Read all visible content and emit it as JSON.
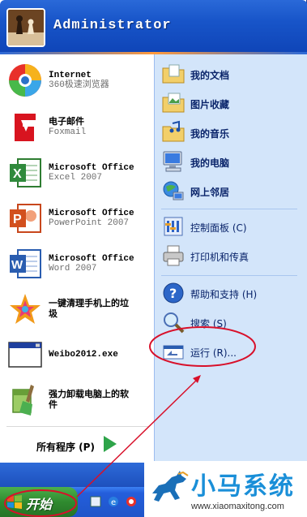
{
  "header": {
    "user_name": "Administrator"
  },
  "programs": [
    {
      "title": "Internet",
      "subtitle": "360极速浏览器"
    },
    {
      "title": "电子邮件",
      "subtitle": "Foxmail"
    },
    {
      "title": "Microsoft Office",
      "subtitle": "Excel 2007"
    },
    {
      "title": "Microsoft Office",
      "subtitle": "PowerPoint 2007"
    },
    {
      "title": "Microsoft Office",
      "subtitle": "Word 2007"
    },
    {
      "title": "一键清理手机上的垃",
      "subtitle": "圾"
    },
    {
      "title": "Weibo2012.exe",
      "subtitle": ""
    },
    {
      "title": "强力卸载电脑上的软",
      "subtitle": "件"
    }
  ],
  "all_programs": {
    "label": "所有程序 (P)"
  },
  "places": [
    {
      "label": "我的文档"
    },
    {
      "label": "图片收藏"
    },
    {
      "label": "我的音乐"
    },
    {
      "label": "我的电脑"
    },
    {
      "label": "网上邻居"
    },
    {
      "label": "控制面板 (C)"
    },
    {
      "label": "打印机和传真"
    },
    {
      "label": "帮助和支持 (H)"
    },
    {
      "label": "搜索 (S)"
    },
    {
      "label": "运行 (R)..."
    }
  ],
  "taskbar": {
    "start_label": "开始"
  },
  "watermark": {
    "brand": "小马系统",
    "url": "www.xiaomaxitong.com"
  },
  "colors": {
    "header_blue": "#1855c9",
    "right_panel": "#d3e5fa",
    "start_green": "#2f8a2f",
    "annotation_red": "#d8102a"
  }
}
